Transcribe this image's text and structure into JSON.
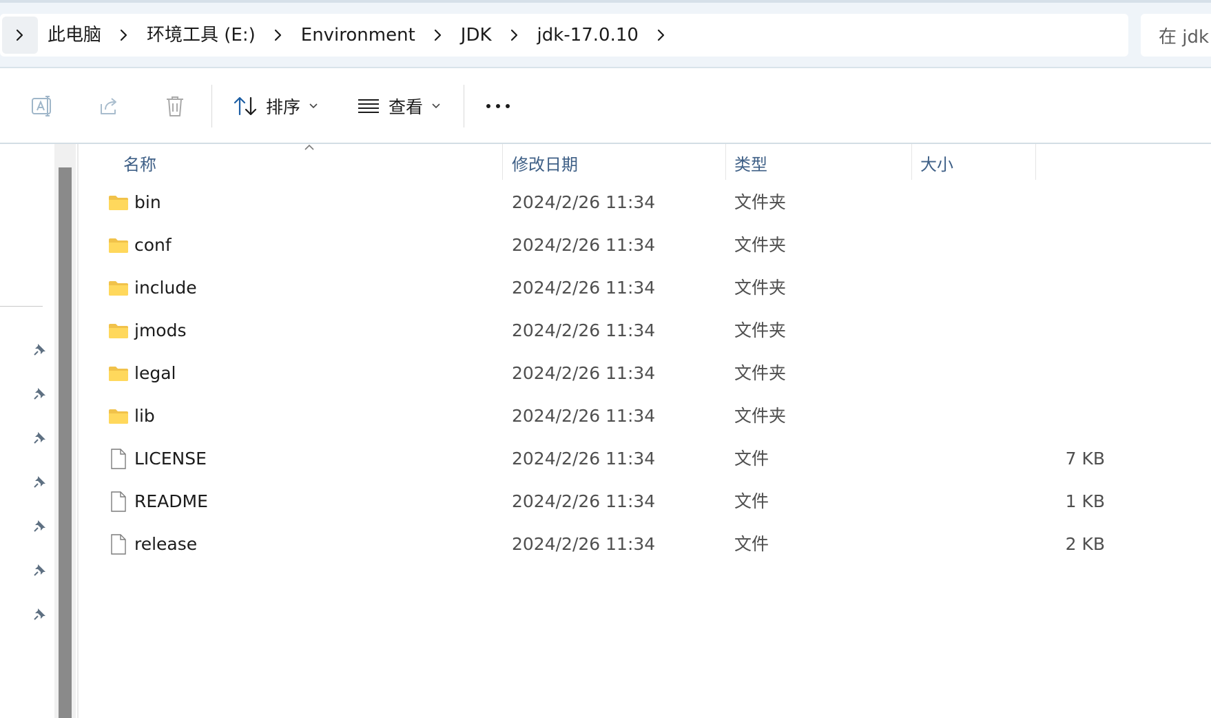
{
  "address_bar": {
    "breadcrumbs": [
      "此电脑",
      "环境工具 (E:)",
      "Environment",
      "JDK",
      "jdk-17.0.10"
    ],
    "search_placeholder": "在 jdk"
  },
  "toolbar": {
    "rename_icon": "rename-icon",
    "share_icon": "share-icon",
    "delete_icon": "trash-icon",
    "sort_label": "排序",
    "view_label": "查看",
    "more_icon": "more-icon"
  },
  "columns": {
    "name": "名称",
    "date": "修改日期",
    "type": "类型",
    "size": "大小"
  },
  "files": [
    {
      "name": "bin",
      "date": "2024/2/26 11:34",
      "type": "文件夹",
      "size": "",
      "kind": "folder"
    },
    {
      "name": "conf",
      "date": "2024/2/26 11:34",
      "type": "文件夹",
      "size": "",
      "kind": "folder"
    },
    {
      "name": "include",
      "date": "2024/2/26 11:34",
      "type": "文件夹",
      "size": "",
      "kind": "folder"
    },
    {
      "name": "jmods",
      "date": "2024/2/26 11:34",
      "type": "文件夹",
      "size": "",
      "kind": "folder"
    },
    {
      "name": "legal",
      "date": "2024/2/26 11:34",
      "type": "文件夹",
      "size": "",
      "kind": "folder"
    },
    {
      "name": "lib",
      "date": "2024/2/26 11:34",
      "type": "文件夹",
      "size": "",
      "kind": "folder"
    },
    {
      "name": "LICENSE",
      "date": "2024/2/26 11:34",
      "type": "文件",
      "size": "7 KB",
      "kind": "file"
    },
    {
      "name": "README",
      "date": "2024/2/26 11:34",
      "type": "文件",
      "size": "1 KB",
      "kind": "file"
    },
    {
      "name": "release",
      "date": "2024/2/26 11:34",
      "type": "文件",
      "size": "2 KB",
      "kind": "file"
    }
  ],
  "colors": {
    "header_text": "#3e5f86",
    "folder_fill": "#ffd34d",
    "chrome_bg": "#eff4f9"
  }
}
